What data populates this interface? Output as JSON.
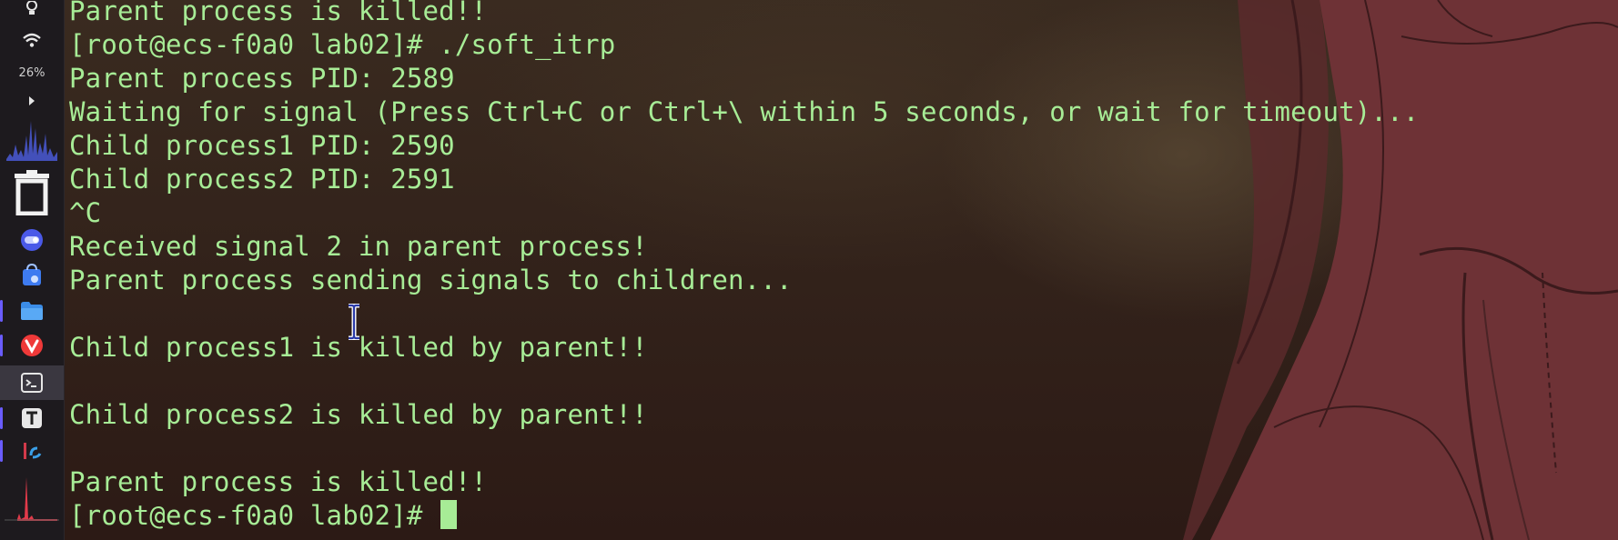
{
  "terminal": {
    "lines": [
      "Parent process is killed!!",
      "[root@ecs-f0a0 lab02]# ./soft_itrp",
      "Parent process PID: 2589",
      "Waiting for signal (Press Ctrl+C or Ctrl+\\ within 5 seconds, or wait for timeout)...",
      "Child process1 PID: 2590",
      "Child process2 PID: 2591",
      "^C",
      "Received signal 2 in parent process!",
      "Parent process sending signals to children...",
      "",
      "Child process1 is killed by parent!!",
      "",
      "Child process2 is killed by parent!!",
      "",
      "Parent process is killed!!"
    ],
    "prompt": "[root@ecs-f0a0 lab02]# ",
    "text_color": "#a7ec96"
  },
  "dock": {
    "battery_percent": "26%",
    "items": [
      {
        "icon": "lightbulb-icon"
      },
      {
        "icon": "wifi-icon"
      },
      {
        "icon": "chevron-right-icon"
      },
      {
        "icon": "activity-graph-icon"
      },
      {
        "icon": "trash-icon"
      },
      {
        "icon": "toggle-app-icon"
      },
      {
        "icon": "store-bag-icon"
      },
      {
        "icon": "folder-icon"
      },
      {
        "icon": "vivaldi-icon"
      },
      {
        "icon": "terminal-icon"
      },
      {
        "icon": "text-editor-icon"
      },
      {
        "icon": "pycharm-icon"
      },
      {
        "icon": "cpu-graph-icon"
      }
    ],
    "accent_color": "#6a5cff"
  }
}
